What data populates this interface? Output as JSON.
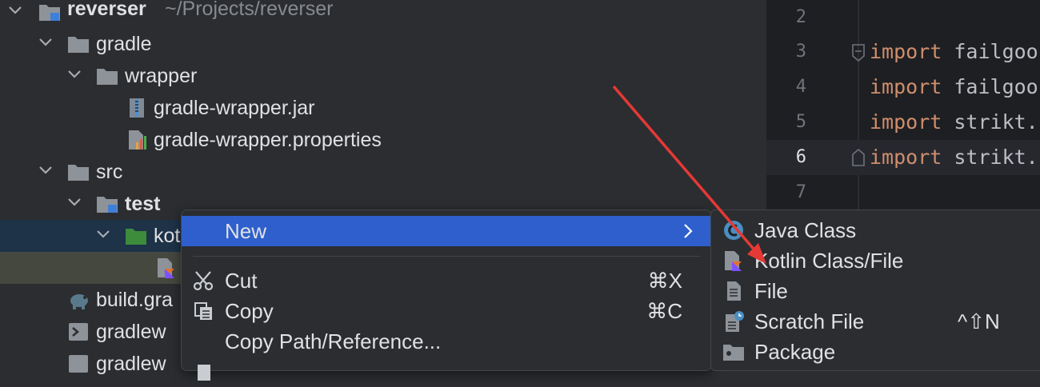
{
  "project_tree": {
    "root": {
      "name": "reverser",
      "path": "~/Projects/reverser"
    },
    "items": [
      {
        "label": "gradle"
      },
      {
        "label": "wrapper"
      },
      {
        "label": "gradle-wrapper.jar"
      },
      {
        "label": "gradle-wrapper.properties"
      },
      {
        "label": "src"
      },
      {
        "label": "test"
      },
      {
        "label": "kot"
      },
      {
        "label": ""
      },
      {
        "label": "build.gra"
      },
      {
        "label": "gradlew"
      },
      {
        "label": "gradlew"
      }
    ]
  },
  "editor": {
    "lines": [
      {
        "num": "2",
        "keyword": "",
        "text": ""
      },
      {
        "num": "3",
        "keyword": "import",
        "text": "failgoo"
      },
      {
        "num": "4",
        "keyword": "import",
        "text": "failgoo"
      },
      {
        "num": "5",
        "keyword": "import",
        "text": "strikt."
      },
      {
        "num": "6",
        "keyword": "import",
        "text": "strikt."
      },
      {
        "num": "7",
        "keyword": "",
        "text": ""
      }
    ],
    "current_line": "6"
  },
  "context_menu": {
    "items": [
      {
        "label": "New",
        "shortcut": "",
        "icon": "none",
        "highlighted": true,
        "has_submenu": true
      },
      {
        "label": "Cut",
        "shortcut": "⌘X",
        "icon": "scissors-icon"
      },
      {
        "label": "Copy",
        "shortcut": "⌘C",
        "icon": "copy-icon"
      },
      {
        "label": "Copy Path/Reference...",
        "shortcut": "",
        "icon": "none"
      }
    ]
  },
  "submenu_new": {
    "items": [
      {
        "label": "Java Class",
        "icon": "java-class-icon",
        "shortcut": ""
      },
      {
        "label": "Kotlin Class/File",
        "icon": "kotlin-file-icon",
        "shortcut": ""
      },
      {
        "label": "File",
        "icon": "file-icon",
        "shortcut": ""
      },
      {
        "label": "Scratch File",
        "icon": "scratch-file-icon",
        "shortcut": "^⇧N"
      },
      {
        "label": "Package",
        "icon": "package-icon",
        "shortcut": ""
      }
    ]
  },
  "colors": {
    "menu_highlight": "#2e5fcc",
    "keyword": "#cf8e6d",
    "annotation_arrow": "#e53935",
    "source_folder": "#3c8c3c"
  }
}
